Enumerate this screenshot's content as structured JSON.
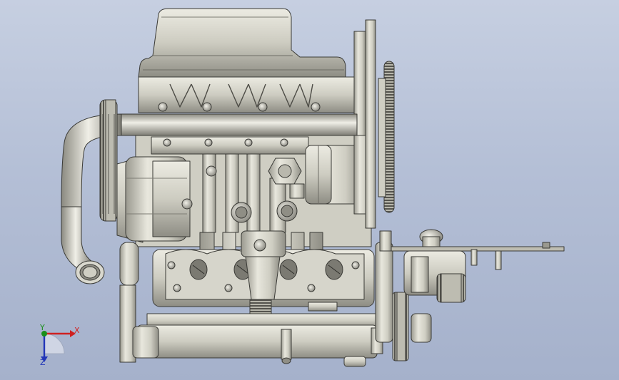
{
  "viewport": {
    "background_top": "#c6cfe1",
    "background_bottom": "#a5b1cb",
    "model_name": "engine-assembly"
  },
  "triad": {
    "x_label": "X",
    "y_label": "Y",
    "z_label": "Z",
    "x_color": "#cf2020",
    "y_color": "#1a8f1a",
    "z_color": "#2236b8"
  },
  "palette": {
    "metal_light": "#e3e2d8",
    "metal_mid": "#c9c8bc",
    "metal_dark": "#8d8c82",
    "outline": "#3a3a36"
  }
}
